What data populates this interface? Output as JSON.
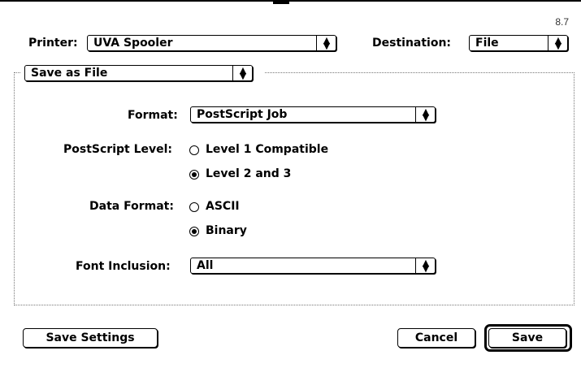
{
  "version": "8.7",
  "printer": {
    "label": "Printer:",
    "value": "UVA Spooler"
  },
  "destination": {
    "label": "Destination:",
    "value": "File"
  },
  "panel": {
    "value": "Save as File"
  },
  "format": {
    "label": "Format:",
    "value": "PostScript Job"
  },
  "postscript_level": {
    "label": "PostScript Level:",
    "options": [
      "Level 1 Compatible",
      "Level 2 and 3"
    ],
    "selected": "Level 2 and 3"
  },
  "data_format": {
    "label": "Data Format:",
    "options": [
      "ASCII",
      "Binary"
    ],
    "selected": "Binary"
  },
  "font_inclusion": {
    "label": "Font Inclusion:",
    "value": "All"
  },
  "buttons": {
    "save_settings": "Save Settings",
    "cancel": "Cancel",
    "save": "Save"
  },
  "icons": {
    "popup_arrows": "updown-arrows-icon"
  }
}
